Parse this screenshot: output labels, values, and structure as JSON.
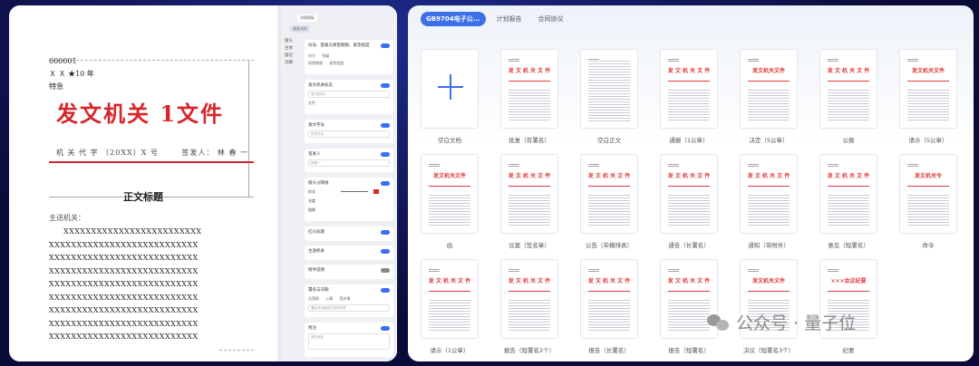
{
  "document": {
    "serial": "000001",
    "secret_level": "Ｘ Ｘ ★10 年",
    "urgency": "特急",
    "issuer_heading": "发文机关 1文件",
    "doc_number": "机 关 代 字 〔20XX〕X 号",
    "signer": "签发人：  林 春 一",
    "subject": "正文标题",
    "addressee": "主送机关：",
    "body_lines": [
      "XXXXXXXXXXXXXXXXXXXXXXXXX",
      "XXXXXXXXXXXXXXXXXXXXXXXXXXX",
      "XXXXXXXXXXXXXXXXXXXXXXXXXXX",
      "XXXXXXXXXXXXXXXXXXXXXXXXXXX",
      "XXXXXXXXXXXXXXXXXXXXXXXXXXX",
      "XXXXXXXXXXXXXXXXXXXXXXXXXXX",
      "XXXXXXXXXXXXXXXXXXXXXXXXXXX",
      "XXXXXXXXXXXXXXXXXXXXXXXXXXX",
      "XXXXXXXXXXXXXXXXXXXXXXXXXXX"
    ]
  },
  "settings": {
    "tabs": [
      "排版模板",
      "版面式样"
    ],
    "nav": [
      "版头",
      "主体",
      "版记",
      "页脚"
    ],
    "cards": [
      {
        "title": "份号、密级与保密期限、紧急程度",
        "options": [
          "份号",
          "密级",
          "保密期限",
          "紧急程度"
        ],
        "toggle": true
      },
      {
        "title": "发文机关标志",
        "input": "发文机关1",
        "options": [
          "文件"
        ],
        "toggle": true
      },
      {
        "title": "发文字号",
        "input": "机关代字",
        "toggle": true
      },
      {
        "title": "签发人",
        "input": "林春一",
        "toggle": true
      },
      {
        "title": "版头分隔线",
        "rows": [
          "样式",
          "长度",
          "粗细"
        ],
        "toggle": true
      },
      {
        "title": "红头标题",
        "toggle": true
      },
      {
        "title": "主送机关",
        "toggle": true
      },
      {
        "title": "附件说明",
        "toggle": false
      },
      {
        "title": "署名与日期",
        "options": [
          "无落款",
          "公章",
          "签名章"
        ],
        "input": "署名并加盖发文机关印章",
        "toggle": true
      },
      {
        "title": "附注",
        "input": "请在此处",
        "toggle": true
      }
    ]
  },
  "gallery": {
    "tabs": [
      "GB9704电子公...",
      "计划报告",
      "合同协议"
    ],
    "tiles": [
      {
        "label": "空白文档",
        "blank": true
      },
      {
        "label": "批复（有署名）",
        "head": "发 文 机 关 文 件"
      },
      {
        "label": "空白正文",
        "head": ""
      },
      {
        "label": "通报（1公章）",
        "head": "发 文 机 关 文 件"
      },
      {
        "label": "决定（5公章）",
        "head": "发文机关文件"
      },
      {
        "label": "公报",
        "head": "发 文 机 关 文 件"
      },
      {
        "label": "请示（5公章）",
        "head": "发文机关文件"
      },
      {
        "label": "函",
        "head": "发文机关文件"
      },
      {
        "label": "议案（签名章）",
        "head": "发 文 机 关 文 件"
      },
      {
        "label": "公告（带横排表）",
        "head": "发 文 机 关 文 件"
      },
      {
        "label": "通告（长署名）",
        "head": "发 文 机 关 文 件"
      },
      {
        "label": "通知（带附件）",
        "head": "发 文 机 关 文 件"
      },
      {
        "label": "意见（短署名）",
        "head": "发 文 机 关 文 件"
      },
      {
        "label": "命令",
        "head": "发文机关令"
      },
      {
        "label": "请示（1公章）",
        "head": "发 文 机 关 文 件"
      },
      {
        "label": "报告（短署名2个）",
        "head": "发 文 机 关 文 件"
      },
      {
        "label": "报告（长署名）",
        "head": "发 文 机 关 文 件"
      },
      {
        "label": "报告（短署名）",
        "head": "发 文 机 关 文 件"
      },
      {
        "label": "决议（短署名3个）",
        "head": "发文机关文件"
      },
      {
        "label": "纪要",
        "head": "×××会议纪要"
      }
    ]
  },
  "watermark": {
    "text": "公众号 · 量子位",
    "icon": "wechat-icon"
  }
}
